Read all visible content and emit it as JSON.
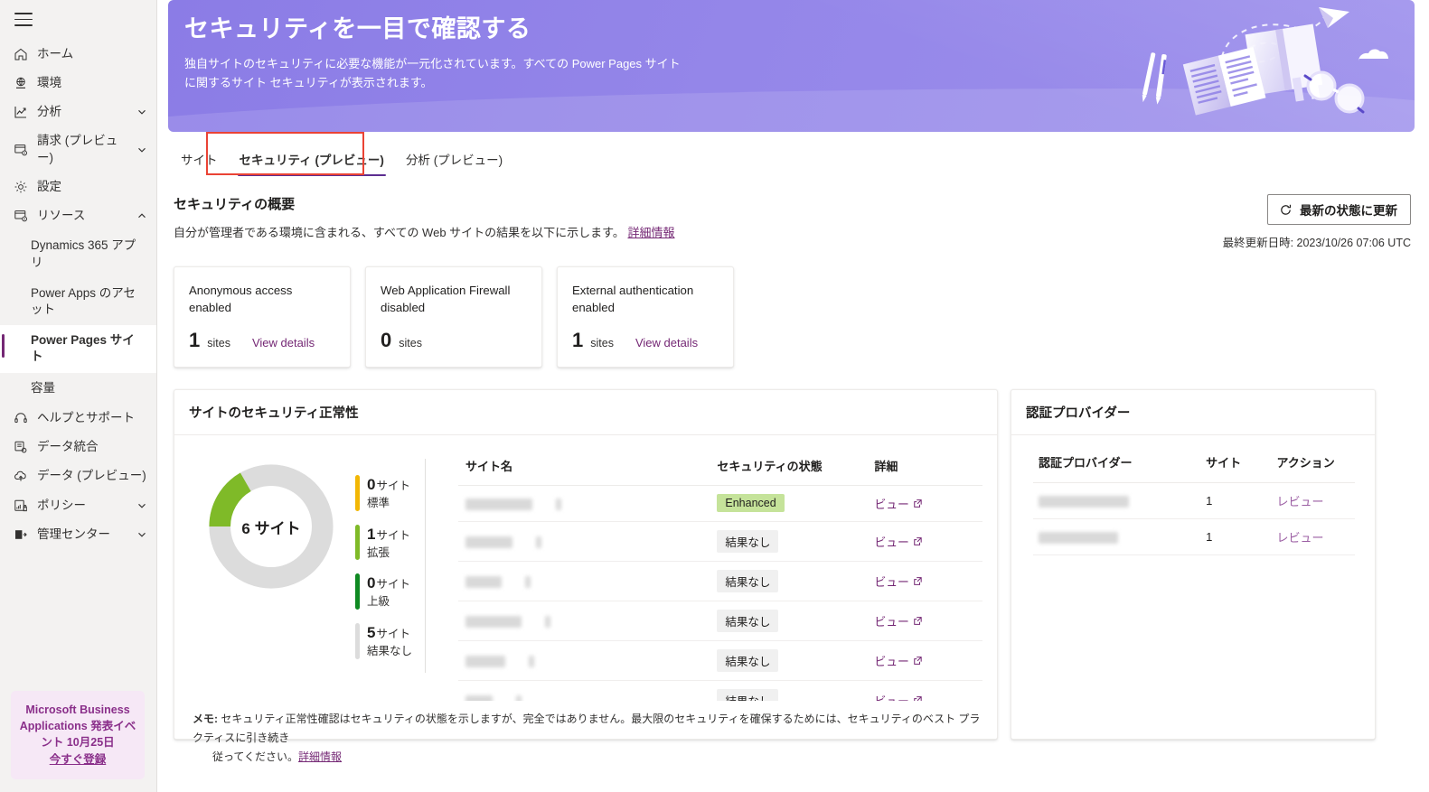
{
  "sidebar": {
    "menu_icon": "hamburger-icon",
    "items": [
      {
        "label": "ホーム",
        "icon": "home-icon",
        "chevron": false
      },
      {
        "label": "環境",
        "icon": "environment-globe-icon",
        "chevron": false
      },
      {
        "label": "分析",
        "icon": "analytics-chart-icon",
        "chevron": true
      },
      {
        "label": "請求 (プレビュー)",
        "icon": "billing-icon",
        "chevron": true
      },
      {
        "label": "設定",
        "icon": "gear-icon",
        "chevron": false
      },
      {
        "label": "リソース",
        "icon": "resources-icon",
        "chevron": true,
        "expanded": true
      }
    ],
    "resources_children": [
      {
        "label": "Dynamics 365 アプリ",
        "selected": false
      },
      {
        "label": "Power Apps のアセット",
        "selected": false
      },
      {
        "label": "Power Pages サイト",
        "selected": true
      },
      {
        "label": "容量",
        "selected": false
      }
    ],
    "items_tail": [
      {
        "label": "ヘルプとサポート",
        "icon": "headset-help-icon",
        "chevron": false
      },
      {
        "label": "データ統合",
        "icon": "data-integration-icon",
        "chevron": false
      },
      {
        "label": "データ (プレビュー)",
        "icon": "data-cloud-icon",
        "chevron": false
      },
      {
        "label": "ポリシー",
        "icon": "policy-icon",
        "chevron": true
      },
      {
        "label": "管理センター",
        "icon": "admin-center-icon",
        "chevron": true
      }
    ],
    "promo": {
      "line1": "Microsoft Business",
      "line2": "Applications 発表イベ",
      "line3": "ント 10月25日",
      "cta": "今すぐ登録"
    }
  },
  "banner": {
    "title": "セキュリティを一目で確認する",
    "subtitle": "独自サイトのセキュリティに必要な機能が一元化されています。すべての Power Pages サイトに関するサイト セキュリティが表示されます。",
    "art_name": "books-pen-glasses-paperplane-illustration",
    "bg_from": "#8b7ce6",
    "bg_to": "#9d90ec"
  },
  "tabs": [
    {
      "label": "サイト",
      "active": false
    },
    {
      "label": "セキュリティ (プレビュー)",
      "active": true
    },
    {
      "label": "分析 (プレビュー)",
      "active": false
    }
  ],
  "section": {
    "title": "セキュリティの概要",
    "desc": "自分が管理者である環境に含まれる、すべての Web サイトの結果を以下に示します。",
    "desc_link": "詳細情報",
    "refresh_label": "最新の状態に更新",
    "refresh_icon": "refresh-circular-arrow-icon",
    "updated_label": "最終更新日時: 2023/10/26 07:06 UTC"
  },
  "kpi_cards": [
    {
      "label": "Anonymous access enabled",
      "value": "1",
      "unit": "sites",
      "link": "View details",
      "has_link": true
    },
    {
      "label": "Web Application Firewall disabled",
      "value": "0",
      "unit": "sites",
      "link": "",
      "has_link": false
    },
    {
      "label": "External authentication enabled",
      "value": "1",
      "unit": "sites",
      "link": "View details",
      "has_link": true
    }
  ],
  "health_panel": {
    "title": "サイトのセキュリティ正常性",
    "center_label": "6 サイト",
    "legend": [
      {
        "count": "0",
        "unit": "サイト",
        "category": "標準",
        "color": "#f2b705"
      },
      {
        "count": "1",
        "unit": "サイト",
        "category": "拡張",
        "color": "#7fba28"
      },
      {
        "count": "0",
        "unit": "サイト",
        "category": "上級",
        "color": "#0f8a22"
      },
      {
        "count": "5",
        "unit": "サイト",
        "category": "結果なし",
        "color": "#dcdcdc"
      }
    ],
    "table": {
      "columns": [
        "サイト名",
        "セキュリティの状態",
        "詳細"
      ],
      "rows": [
        {
          "site": "",
          "redact_w": 74,
          "status": "Enhanced",
          "status_type": "enh",
          "detail": "ビュー"
        },
        {
          "site": "",
          "redact_w": 52,
          "status": "結果なし",
          "status_type": "none",
          "detail": "ビュー"
        },
        {
          "site": "",
          "redact_w": 40,
          "status": "結果なし",
          "status_type": "none",
          "detail": "ビュー"
        },
        {
          "site": "",
          "redact_w": 62,
          "status": "結果なし",
          "status_type": "none",
          "detail": "ビュー"
        },
        {
          "site": "",
          "redact_w": 44,
          "status": "結果なし",
          "status_type": "none",
          "detail": "ビュー"
        },
        {
          "site": "",
          "redact_w": 30,
          "status": "結果なし",
          "status_type": "none",
          "detail": "ビュー"
        }
      ]
    },
    "note_prefix": "メモ:",
    "note_text": " セキュリティ正常性確認はセキュリティの状態を示しますが、完全ではありません。最大限のセキュリティを確保するためには、セキュリティのベスト プラクティスに引き続き",
    "note_text2": "従ってください。",
    "note_link": "詳細情報"
  },
  "auth_panel": {
    "title": "認証プロバイダー",
    "columns": [
      "認証プロバイダー",
      "サイト",
      "アクション"
    ],
    "rows": [
      {
        "provider": "",
        "redact_w": 100,
        "sites": "1",
        "action": "レビュー"
      },
      {
        "provider": "",
        "redact_w": 88,
        "sites": "1",
        "action": "レビュー"
      }
    ]
  },
  "chart_data": {
    "type": "pie",
    "title": "サイトのセキュリティ正常性",
    "categories": [
      "標準",
      "拡張",
      "上級",
      "結果なし"
    ],
    "values": [
      0,
      1,
      0,
      5
    ],
    "colors": [
      "#f2b705",
      "#7fba28",
      "#0f8a22",
      "#dcdcdc"
    ],
    "total": 6,
    "center_label": "6 サイト",
    "legend_position": "right",
    "grid": false
  }
}
